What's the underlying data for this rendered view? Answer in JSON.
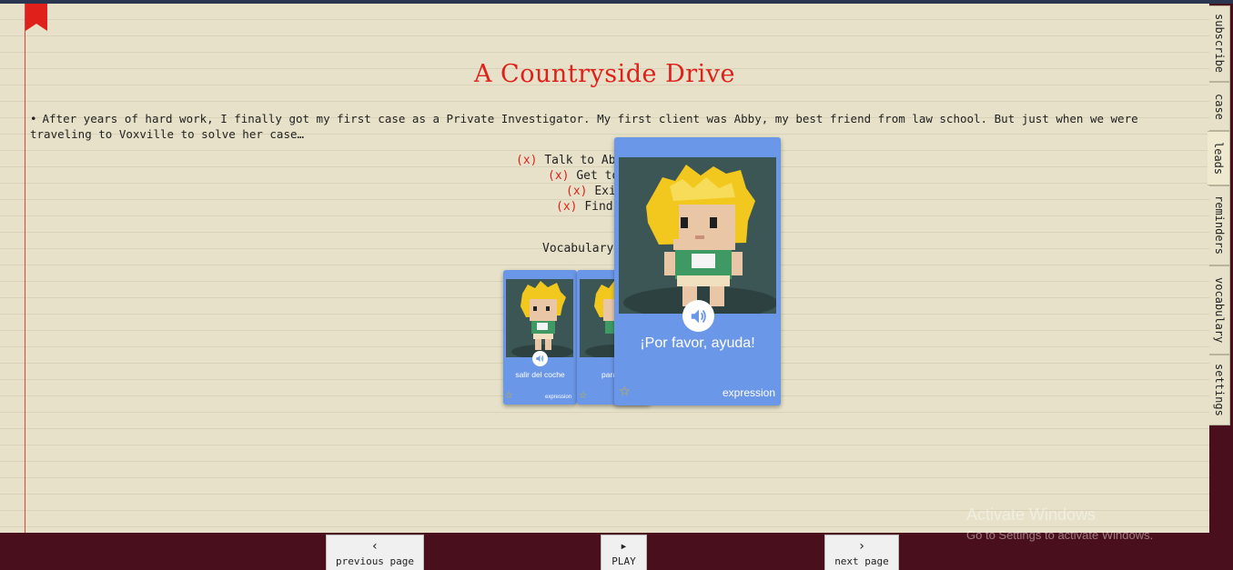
{
  "story": {
    "title": "A Countryside Drive",
    "intro": "After years of hard work, I finally got my first case as a Private Investigator. My first client was Abby, my best friend from law school. But just when we were traveling to Voxville to solve her case…"
  },
  "objectives": [
    {
      "mark": "(x)",
      "text": "Talk to Abby"
    },
    {
      "mark": "(x)",
      "text": "Get to V"
    },
    {
      "mark": "(x)",
      "text": "Exit"
    },
    {
      "mark": "(x)",
      "text": "Find a"
    }
  ],
  "vocabulary": {
    "label": "Vocabulary",
    "cards": [
      {
        "word": "salir del coche",
        "type": "expression",
        "star": "☆",
        "icon": "speaker-icon"
      },
      {
        "word": "parar e",
        "type": "expression",
        "star": "☆",
        "icon": "speaker-icon"
      },
      {
        "word": "¡Por favor, ayuda!",
        "type": "expression",
        "star": "☆",
        "icon": "speaker-icon"
      }
    ],
    "card_color": "#6b97e8"
  },
  "side_tabs": [
    "subscribe",
    "case",
    "leads",
    "reminders",
    "vocabulary",
    "settings"
  ],
  "active_tab": "leads",
  "nav": {
    "previous": {
      "icon": "‹",
      "label": "previous page"
    },
    "play": {
      "icon": "▸",
      "label": "PLAY"
    },
    "next": {
      "icon": "›",
      "label": "next page"
    }
  },
  "watermark": {
    "title": "Activate Windows",
    "subtitle": "Go to Settings to activate Windows."
  },
  "colors": {
    "accent_red": "#e0201a",
    "paper": "#e6e1c8",
    "frame": "#4a0f1c"
  }
}
